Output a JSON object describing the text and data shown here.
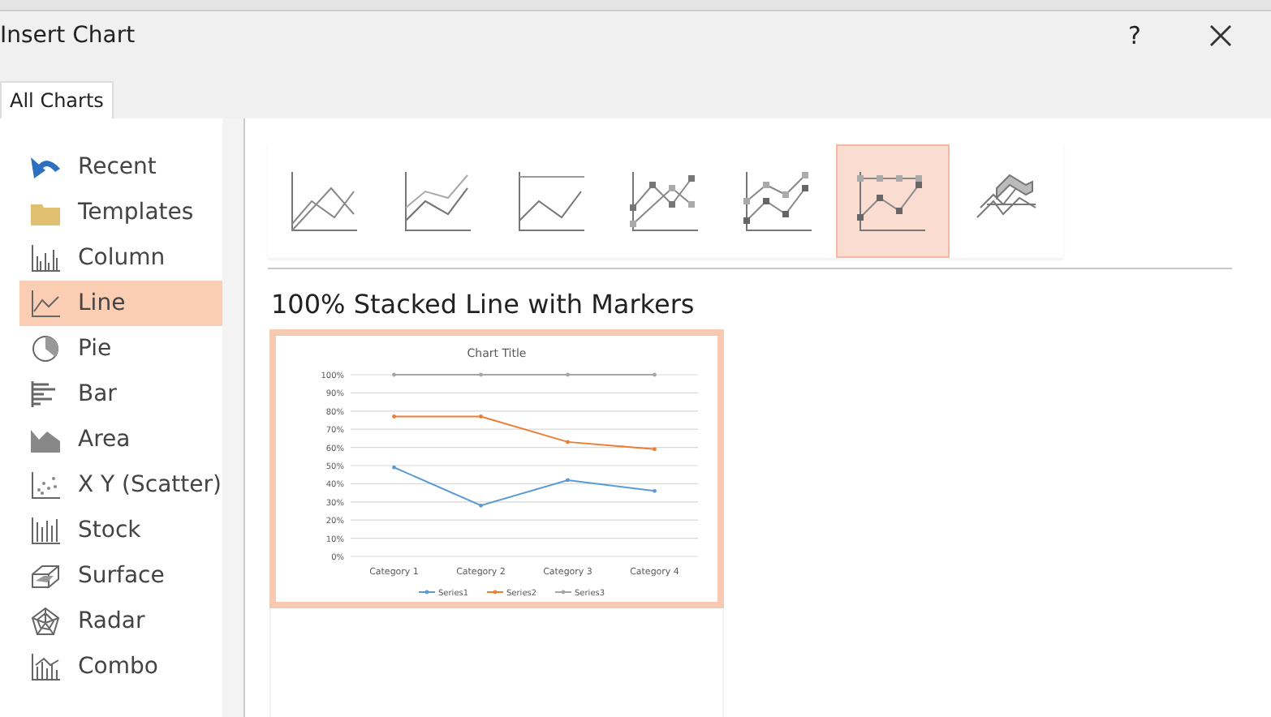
{
  "window": {
    "title": "Insert Chart",
    "help": "?"
  },
  "tabs": [
    {
      "label": "All Charts",
      "selected": true
    }
  ],
  "sidebar": {
    "items": [
      {
        "label": "Recent",
        "kind": "recent",
        "selected": false
      },
      {
        "label": "Templates",
        "kind": "templates",
        "selected": false
      },
      {
        "label": "Column",
        "kind": "column",
        "selected": false
      },
      {
        "label": "Line",
        "kind": "line",
        "selected": true
      },
      {
        "label": "Pie",
        "kind": "pie",
        "selected": false
      },
      {
        "label": "Bar",
        "kind": "bar",
        "selected": false
      },
      {
        "label": "Area",
        "kind": "area",
        "selected": false
      },
      {
        "label": "X Y (Scatter)",
        "kind": "scatter",
        "selected": false
      },
      {
        "label": "Stock",
        "kind": "stock",
        "selected": false
      },
      {
        "label": "Surface",
        "kind": "surface",
        "selected": false
      },
      {
        "label": "Radar",
        "kind": "radar",
        "selected": false
      },
      {
        "label": "Combo",
        "kind": "combo",
        "selected": false
      }
    ]
  },
  "subtypes": [
    {
      "kind": "line",
      "selected": false
    },
    {
      "kind": "stacked",
      "selected": false
    },
    {
      "kind": "percent",
      "selected": false
    },
    {
      "kind": "line-markers",
      "selected": false
    },
    {
      "kind": "stacked-markers",
      "selected": false
    },
    {
      "kind": "percent-markers",
      "selected": true
    },
    {
      "kind": "perspective",
      "selected": false
    }
  ],
  "preview": {
    "heading": "100% Stacked Line with Markers",
    "chart_data": {
      "type": "line",
      "title": "Chart Title",
      "categories": [
        "Category 1",
        "Category 2",
        "Category 3",
        "Category 4"
      ],
      "series": [
        {
          "name": "Series1",
          "color": "#5b9bd5",
          "values": [
            49,
            28,
            42,
            36
          ]
        },
        {
          "name": "Series2",
          "color": "#ed7d31",
          "values": [
            77,
            77,
            63,
            59
          ]
        },
        {
          "name": "Series3",
          "color": "#a5a5a5",
          "values": [
            100,
            100,
            100,
            100
          ]
        }
      ],
      "ylim": [
        0,
        100
      ],
      "grid": true,
      "legend": true,
      "yticks": [
        {
          "value": 0,
          "label": "0%"
        },
        {
          "value": 10,
          "label": "10%"
        },
        {
          "value": 20,
          "label": "20%"
        },
        {
          "value": 30,
          "label": "30%"
        },
        {
          "value": 40,
          "label": "40%"
        },
        {
          "value": 50,
          "label": "50%"
        },
        {
          "value": 60,
          "label": "60%"
        },
        {
          "value": 70,
          "label": "70%"
        },
        {
          "value": 80,
          "label": "80%"
        },
        {
          "value": 90,
          "label": "90%"
        },
        {
          "value": 100,
          "label": "100%"
        }
      ]
    }
  }
}
